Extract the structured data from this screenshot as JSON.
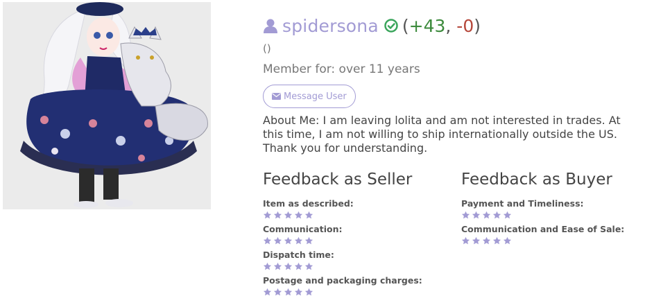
{
  "profile": {
    "username": "spidersona",
    "score_open": "(",
    "score_positive": "+43",
    "score_sep": ", ",
    "score_negative": "-0",
    "score_close": ")",
    "location": "()",
    "member_for": "Member for: over 11 years",
    "message_button": "Message User",
    "about": "About Me: I am leaving lolita and am not interested in trades. At this time, I am not willing to ship internationally outside the US. Thank you for understanding."
  },
  "feedback": {
    "seller": {
      "title": "Feedback as Seller",
      "items": [
        {
          "label": "Item as described:",
          "stars": 5
        },
        {
          "label": "Communication:",
          "stars": 5
        },
        {
          "label": "Dispatch time:",
          "stars": 5
        },
        {
          "label": "Postage and packaging charges:",
          "stars": 5
        }
      ]
    },
    "buyer": {
      "title": "Feedback as Buyer",
      "items": [
        {
          "label": "Payment and Timeliness:",
          "stars": 5
        },
        {
          "label": "Communication and Ease of Sale:",
          "stars": 5
        }
      ]
    }
  },
  "colors": {
    "accent": "#a29bd4",
    "positive": "#3c8a3c",
    "negative": "#b5473a",
    "verified": "#3ba55c"
  },
  "icons": {
    "user": "user-icon",
    "verified": "check-circle-icon",
    "message": "envelope-icon",
    "star": "star-icon"
  }
}
